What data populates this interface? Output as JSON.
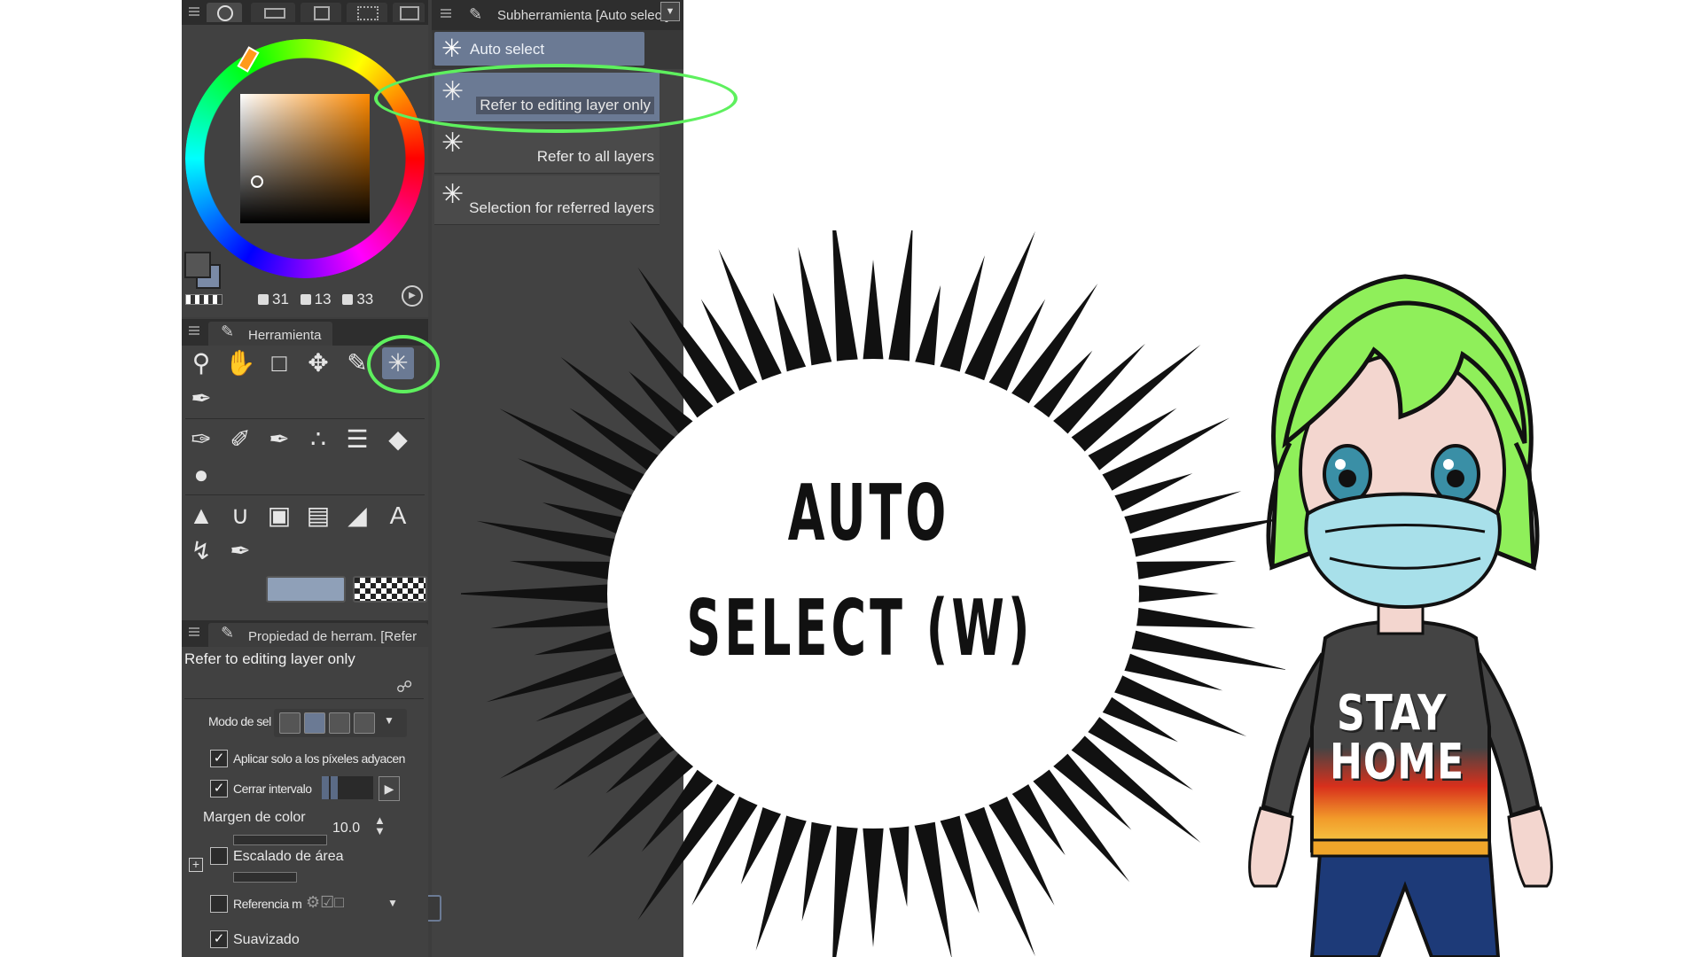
{
  "color_panel": {
    "hsv": {
      "h": "31",
      "s": "13",
      "v": "33"
    }
  },
  "subtool_panel": {
    "title": "Subherramienta [Auto select]",
    "group_label": "Auto select",
    "items": [
      {
        "label": "Refer to editing layer only",
        "active": true
      },
      {
        "label": "Refer to all layers",
        "active": false
      },
      {
        "label": "Selection for referred layers",
        "active": false
      }
    ]
  },
  "tool_panel": {
    "title": "Herramienta"
  },
  "tool_property": {
    "title": "Propiedad de herram. [Refer",
    "subtool_name": "Refer to editing layer only",
    "selection_mode_label": "Modo de sel",
    "apply_adjacent_label": "Aplicar solo a los píxeles adyacen",
    "apply_adjacent_checked": true,
    "close_gap_label": "Cerrar intervalo",
    "close_gap_checked": true,
    "color_margin_label": "Margen de color",
    "color_margin_value": "10.0",
    "area_scaling_label": "Escalado de área",
    "area_scaling_checked": false,
    "reference_label": "Referencia m",
    "reference_checked": false,
    "antialias_label": "Suavizado",
    "antialias_checked": true
  },
  "burst_text": {
    "line1": "AUTO",
    "line2": "SELECT (W)"
  },
  "character": {
    "shirt_line1": "STAY",
    "shirt_line2": "HOME"
  },
  "colors": {
    "annotation_green": "#5ef05e",
    "panel_bg": "#414141",
    "selection_blue": "#6b7a94",
    "hair_green": "#8fef5a",
    "mask_blue": "#a8e0ea"
  }
}
